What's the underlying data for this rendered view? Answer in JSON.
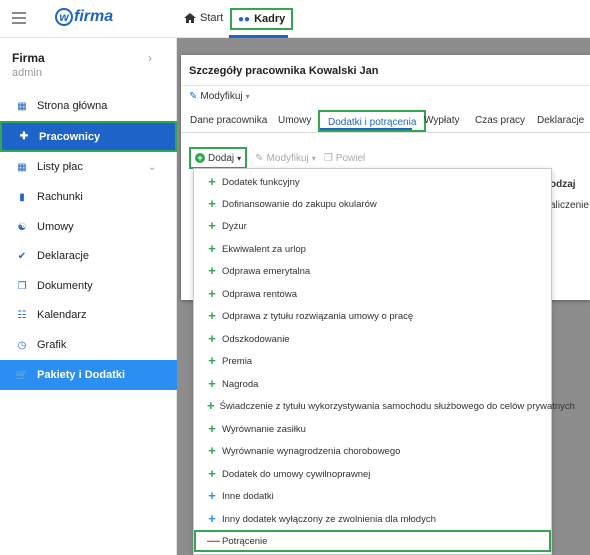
{
  "topbar": {
    "logo_text": "firma",
    "logo_letter": "w",
    "nav_start": "Start",
    "nav_kadry": "Kadry"
  },
  "sidebar": {
    "company": "Firma",
    "user": "admin",
    "items": [
      {
        "label": "Strona główna",
        "icon": "dashboard-icon"
      },
      {
        "label": "Pracownicy",
        "icon": "add-user-icon"
      },
      {
        "label": "Listy płac",
        "icon": "calculator-icon"
      },
      {
        "label": "Rachunki",
        "icon": "document-icon"
      },
      {
        "label": "Umowy",
        "icon": "handshake-icon"
      },
      {
        "label": "Deklaracje",
        "icon": "clipboard-check-icon"
      },
      {
        "label": "Dokumenty",
        "icon": "files-icon"
      },
      {
        "label": "Kalendarz",
        "icon": "calendar-icon"
      },
      {
        "label": "Grafik",
        "icon": "clock-icon"
      },
      {
        "label": "Pakiety i Dodatki",
        "icon": "cart-icon"
      }
    ]
  },
  "panel": {
    "title": "Szczegóły pracownika Kowalski Jan",
    "modify_label": "Modyfikuj",
    "tabs": [
      "Dane pracownika",
      "Umowy",
      "Dodatki i potrącenia",
      "Wypłaty",
      "Czas pracy",
      "Deklaracje"
    ],
    "toolbar": {
      "add_label": "Dodaj",
      "modify_label": "Modyfikuj",
      "duplicate_label": "Powiel"
    },
    "column_header": "odzaj",
    "column_value": "aliczenie"
  },
  "dropdown": {
    "items": [
      {
        "label": "Dodatek funkcyjny",
        "sign": "+",
        "color": "green"
      },
      {
        "label": "Dofinansowanie do zakupu okularów",
        "sign": "+",
        "color": "green"
      },
      {
        "label": "Dyżur",
        "sign": "+",
        "color": "green"
      },
      {
        "label": "Ekwiwalent za urlop",
        "sign": "+",
        "color": "green"
      },
      {
        "label": "Odprawa emerytalna",
        "sign": "+",
        "color": "green"
      },
      {
        "label": "Odprawa rentowa",
        "sign": "+",
        "color": "green"
      },
      {
        "label": "Odprawa z tytułu rozwiązania umowy o pracę",
        "sign": "+",
        "color": "green"
      },
      {
        "label": "Odszkodowanie",
        "sign": "+",
        "color": "green"
      },
      {
        "label": "Premia",
        "sign": "+",
        "color": "green"
      },
      {
        "label": "Nagroda",
        "sign": "+",
        "color": "green"
      },
      {
        "label": "Świadczenie z tytułu wykorzystywania samochodu służbowego do celów prywatnych",
        "sign": "+",
        "color": "green"
      },
      {
        "label": "Wyrównanie zasiłku",
        "sign": "+",
        "color": "green"
      },
      {
        "label": "Wyrównanie wynagrodzenia chorobowego",
        "sign": "+",
        "color": "green"
      },
      {
        "label": "Dodatek do umowy cywilnoprawnej",
        "sign": "+",
        "color": "green"
      },
      {
        "label": "Inne dodatki",
        "sign": "+",
        "color": "blue"
      },
      {
        "label": "Inny dodatek wyłączony ze zwolnienia dla młodych",
        "sign": "+",
        "color": "blue"
      },
      {
        "label": "Potrącenie",
        "sign": "—",
        "color": "red"
      }
    ]
  },
  "colors": {
    "accent": "#1e64c8",
    "highlight_border": "#2fa84f",
    "sidebar_light": "#2a8ef2",
    "deduction": "#e05050"
  }
}
